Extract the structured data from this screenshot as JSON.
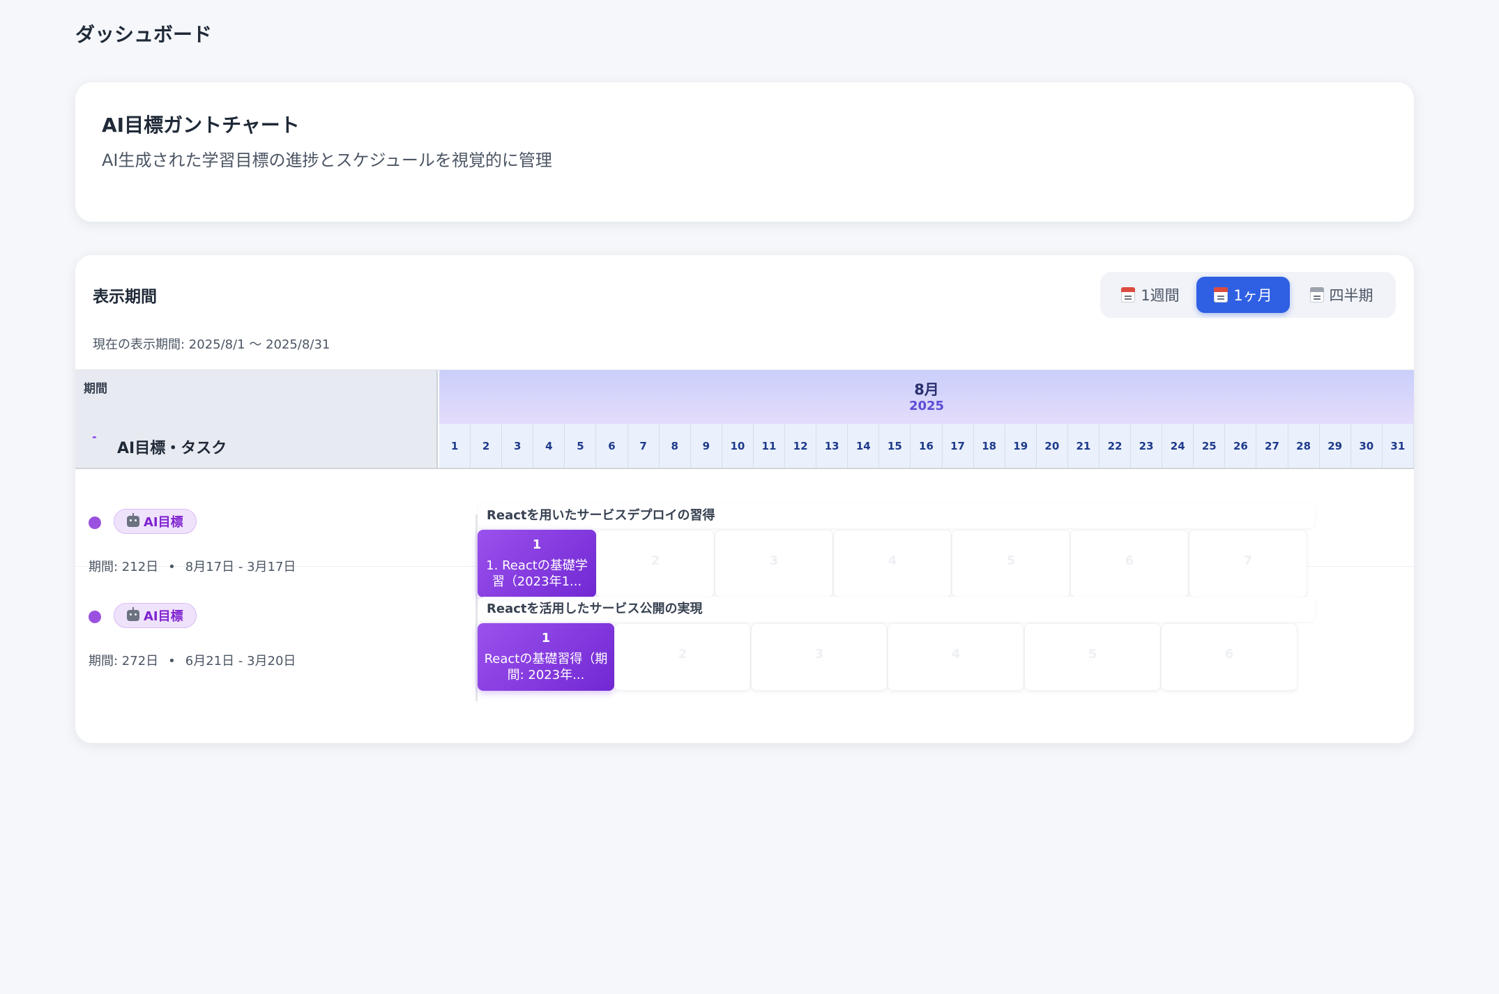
{
  "page": {
    "title": "ダッシュボード"
  },
  "intro": {
    "title": "AI目標ガントチャート",
    "description": "AI生成された学習目標の進捗とスケジュールを視覚的に管理"
  },
  "period": {
    "title": "表示期間",
    "current": "現在の表示期間: 2025/8/1 〜 2025/8/31",
    "options": [
      {
        "label": "1週間",
        "icon": "calendar-icon",
        "active": false
      },
      {
        "label": "1ヶ月",
        "icon": "calendar-icon",
        "active": true
      },
      {
        "label": "四半期",
        "icon": "calendar-pad-icon",
        "active": false
      }
    ]
  },
  "gantt_header": {
    "period_label": "期間",
    "collapse_symbol": "-",
    "task_label": "AI目標・タスク",
    "month": "8月",
    "year": "2025",
    "days": [
      "1",
      "2",
      "3",
      "4",
      "5",
      "6",
      "7",
      "8",
      "9",
      "10",
      "11",
      "12",
      "13",
      "14",
      "15",
      "16",
      "17",
      "18",
      "19",
      "20",
      "21",
      "22",
      "23",
      "24",
      "25",
      "26",
      "27",
      "28",
      "29",
      "30",
      "31"
    ]
  },
  "rows": [
    {
      "badge": "AI目標",
      "badge_icon": "robot-icon",
      "duration": "期間: 212日",
      "separator": "•",
      "range": "8月17日 - 3月17日",
      "goal_title": "Reactを用いたサービスデプロイの習得",
      "dot_color": "#9b51e0",
      "blocks": [
        {
          "num": "1",
          "label": "1. Reactの基礎学習（2023年1...",
          "active": true
        },
        {
          "num": "2",
          "label": "",
          "active": false
        },
        {
          "num": "3",
          "label": "",
          "active": false
        },
        {
          "num": "4",
          "label": "",
          "active": false
        },
        {
          "num": "5",
          "label": "",
          "active": false
        },
        {
          "num": "6",
          "label": "",
          "active": false
        },
        {
          "num": "7",
          "label": "",
          "active": false
        }
      ]
    },
    {
      "badge": "AI目標",
      "badge_icon": "robot-icon",
      "duration": "期間: 272日",
      "separator": "•",
      "range": "6月21日 - 3月20日",
      "goal_title": "Reactを活用したサービス公開の実現",
      "dot_color": "#9b51e0",
      "blocks": [
        {
          "num": "1",
          "label": "Reactの基礎習得（期間: 2023年...",
          "active": true
        },
        {
          "num": "2",
          "label": "",
          "active": false
        },
        {
          "num": "3",
          "label": "",
          "active": false
        },
        {
          "num": "4",
          "label": "",
          "active": false
        },
        {
          "num": "5",
          "label": "",
          "active": false
        },
        {
          "num": "6",
          "label": "",
          "active": false
        }
      ]
    }
  ]
}
